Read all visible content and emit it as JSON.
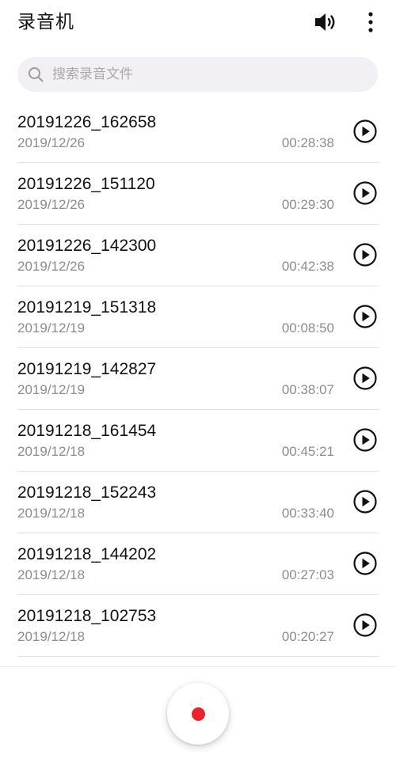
{
  "app": {
    "title": "录音机"
  },
  "toolbar": {
    "speaker_icon": "speaker-icon",
    "more_icon": "more-vertical-icon"
  },
  "search": {
    "placeholder": "搜索录音文件",
    "value": "",
    "icon": "search-icon"
  },
  "recordings": [
    {
      "name": "20191226_162658",
      "date": "2019/12/26",
      "duration": "00:28:38"
    },
    {
      "name": "20191226_151120",
      "date": "2019/12/26",
      "duration": "00:29:30"
    },
    {
      "name": "20191226_142300",
      "date": "2019/12/26",
      "duration": "00:42:38"
    },
    {
      "name": "20191219_151318",
      "date": "2019/12/19",
      "duration": "00:08:50"
    },
    {
      "name": "20191219_142827",
      "date": "2019/12/19",
      "duration": "00:38:07"
    },
    {
      "name": "20191218_161454",
      "date": "2019/12/18",
      "duration": "00:45:21"
    },
    {
      "name": "20191218_152243",
      "date": "2019/12/18",
      "duration": "00:33:40"
    },
    {
      "name": "20191218_144202",
      "date": "2019/12/18",
      "duration": "00:27:03"
    },
    {
      "name": "20191218_102753",
      "date": "2019/12/18",
      "duration": "00:20:27"
    }
  ],
  "record_button": {
    "icon": "record-dot-icon",
    "color": "#e8232a"
  },
  "colors": {
    "search_background": "#f2f0f4",
    "secondary_text": "#8c8c8c",
    "record_red": "#e8232a"
  }
}
